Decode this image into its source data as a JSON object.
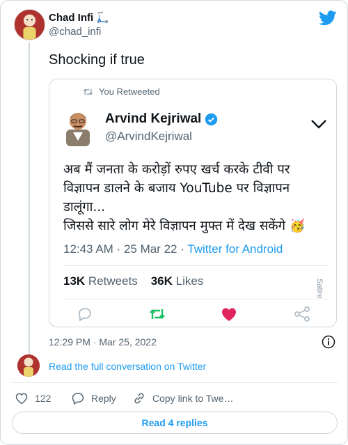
{
  "tweet": {
    "author_name": "Chad Infi 🛴",
    "author_handle": "@chad_infi",
    "text": "Shocking if true",
    "timestamp": "12:29 PM · Mar 25, 2022",
    "read_conversation": "Read the full conversation on Twitter",
    "likes": "122",
    "reply_label": "Reply",
    "copy_link_label": "Copy link to Twe…",
    "read_replies": "Read 4 replies"
  },
  "embedded": {
    "retweet_label": "You Retweeted",
    "author_name": "Arvind Kejriwal",
    "author_handle": "@ArvindKejriwal",
    "text_line1": "अब मैं जनता के करोड़ों रुपए खर्च करके टीवी पर",
    "text_line2": "विज्ञापन डालने के बजाय YouTube पर विज्ञापन",
    "text_line3": "डालूंगा...",
    "text_line4": "जिससे सारे लोग मेरे विज्ञापन मुफ्त में देख सकेंगे",
    "emoji": "🥳",
    "time": "12:43 AM",
    "date": "25 Mar 22",
    "source": "Twitter for Android",
    "retweets_count": "13K",
    "retweets_label": "Retweets",
    "likes_count": "36K",
    "likes_label": "Likes",
    "watermark": "Satire"
  },
  "icons": {
    "brand": "twitter-bird-icon",
    "verified": "verified-badge-icon",
    "menu": "chevron-down-icon",
    "reply": "reply-icon",
    "retweet": "retweet-icon",
    "like": "heart-icon",
    "share": "share-icon",
    "info": "info-icon",
    "copy_link": "link-icon"
  },
  "colors": {
    "accent": "#1d9bf0",
    "retweet_green": "#17bf63",
    "like_red": "#e0245e",
    "muted_text": "#536471"
  }
}
